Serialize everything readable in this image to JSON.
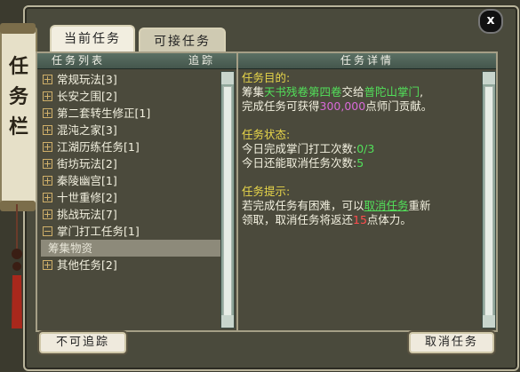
{
  "window": {
    "side_title": [
      "任",
      "务",
      "栏"
    ],
    "close_label": "x"
  },
  "tabs": [
    {
      "label": "当前任务",
      "active": true
    },
    {
      "label": "可接任务",
      "active": false
    }
  ],
  "left_panel": {
    "header_title": "任务列表",
    "header_track": "追踪",
    "items": [
      {
        "label": "常规玩法[3]",
        "expanded": false
      },
      {
        "label": "长安之围[2]",
        "expanded": false
      },
      {
        "label": "第二套转生修正[1]",
        "expanded": false
      },
      {
        "label": "混沌之家[3]",
        "expanded": false
      },
      {
        "label": "江湖历练任务[1]",
        "expanded": false
      },
      {
        "label": "街坊玩法[2]",
        "expanded": false
      },
      {
        "label": "秦陵幽宫[1]",
        "expanded": false
      },
      {
        "label": "十世重修[2]",
        "expanded": false
      },
      {
        "label": "挑战玩法[7]",
        "expanded": false
      },
      {
        "label": "掌门打工任务[1]",
        "expanded": true
      },
      {
        "label": "其他任务[2]",
        "expanded": false
      }
    ],
    "sub_item": "筹集物资"
  },
  "right_panel": {
    "header_title": "任务详情",
    "objective_heading": "任务目的:",
    "objective_1a": "筹集",
    "objective_item": "天书残卷第四卷",
    "objective_1b": "交给",
    "objective_npc": "普陀山掌门",
    "objective_1c": ",",
    "objective_2a": "完成任务可获得",
    "objective_reward": "300,000",
    "objective_2b": "点师门贡献。",
    "status_heading": "任务状态:",
    "status_1a": "今日完成掌门打工次数:",
    "status_1b": "0/3",
    "status_2a": "今日还能取消任务次数:",
    "status_2b": "5",
    "hint_heading": "任务提示:",
    "hint_1a": "若完成任务有困难，可以",
    "hint_link": "取消任务",
    "hint_1b": "重新",
    "hint_2a": "领取，取消任务将返还",
    "hint_2b": "15",
    "hint_2c": "点体力。"
  },
  "buttons": {
    "untrackable": "不可追踪",
    "cancel_task": "取消任务"
  },
  "colors": {
    "highlight_green": "#52e05a",
    "highlight_yellow": "#e8d64a",
    "highlight_red": "#ff4d4d"
  }
}
